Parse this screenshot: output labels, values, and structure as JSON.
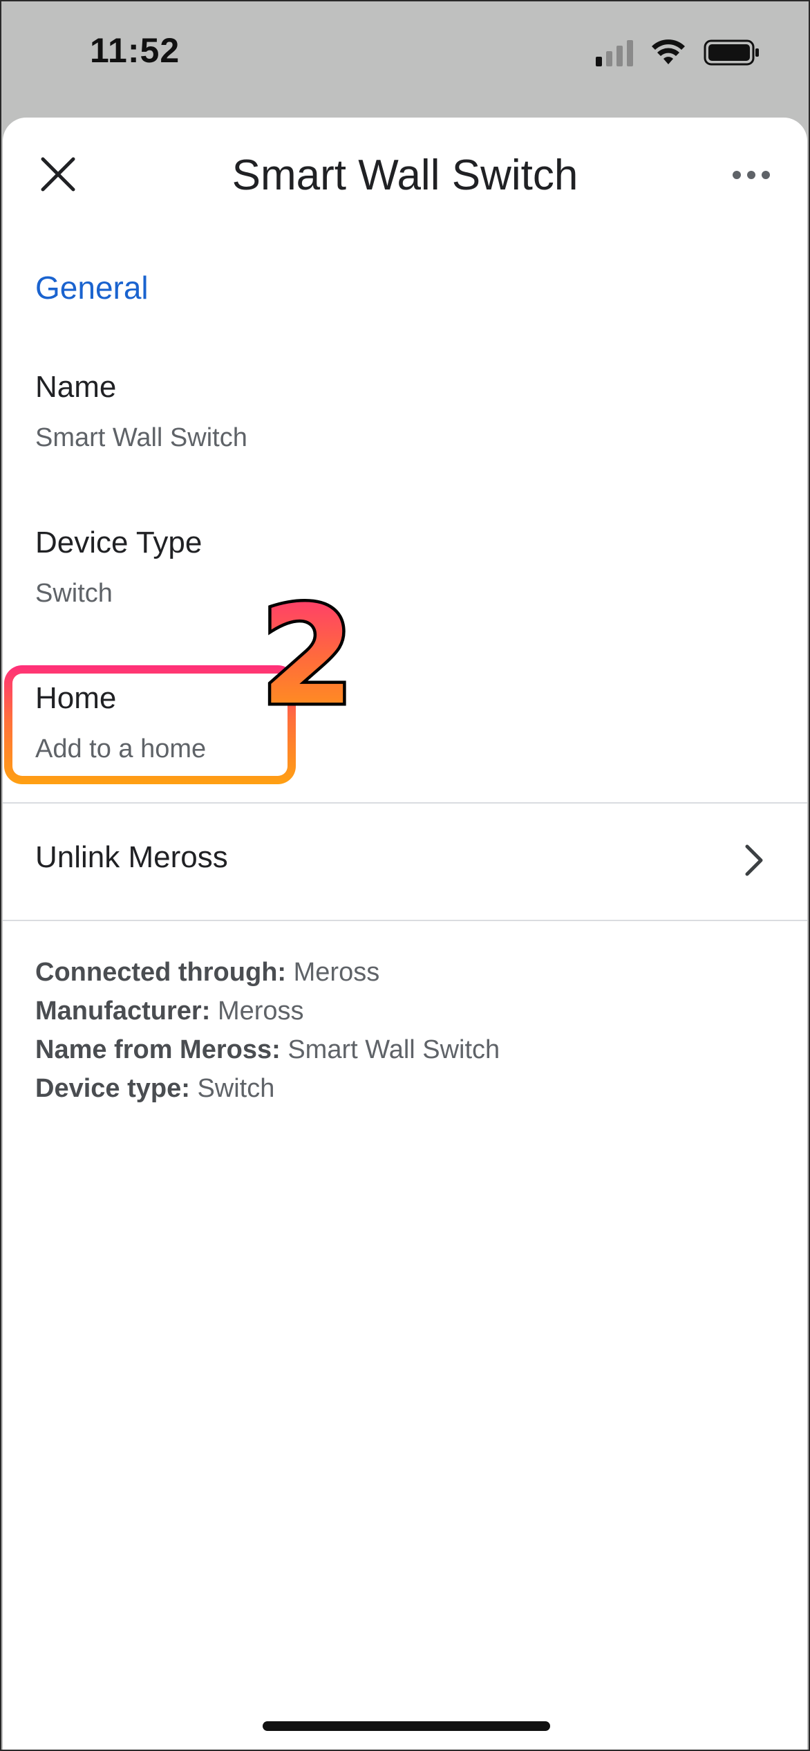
{
  "status_bar": {
    "time": "11:52"
  },
  "header": {
    "title": "Smart Wall Switch",
    "close_icon": "close-icon",
    "more_icon": "more-horizontal-icon"
  },
  "section": {
    "general_label": "General"
  },
  "fields": {
    "name": {
      "label": "Name",
      "value": "Smart Wall Switch"
    },
    "device_type": {
      "label": "Device Type",
      "value": "Switch"
    },
    "home": {
      "label": "Home",
      "value": "Add to a home"
    }
  },
  "annotation": {
    "step_number": "2",
    "gradient_top": "#ff2f7a",
    "gradient_bottom": "#ffa012"
  },
  "unlink": {
    "label": "Unlink Meross",
    "chevron_icon": "chevron-right-icon"
  },
  "info": {
    "connected_through_label": "Connected through:",
    "connected_through_value": "Meross",
    "manufacturer_label": "Manufacturer:",
    "manufacturer_value": "Meross",
    "name_from_label": "Name from Meross:",
    "name_from_value": "Smart Wall Switch",
    "device_type_label": "Device type:",
    "device_type_value": "Switch"
  },
  "colors": {
    "accent": "#1a63cf",
    "backdrop": "#bfc0bf"
  }
}
